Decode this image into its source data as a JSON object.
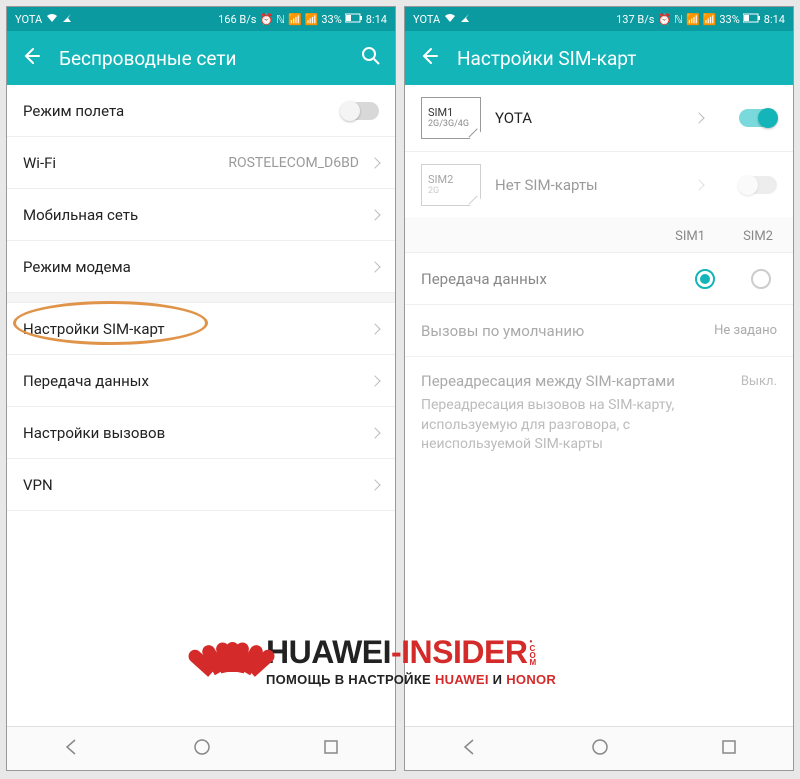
{
  "status": {
    "carrier": "YOTA",
    "speed_left": "166 B/s",
    "speed_right": "137 B/s",
    "battery": "33%",
    "time": "8:14"
  },
  "left_phone": {
    "header_title": "Беспроводные сети",
    "rows": [
      {
        "label": "Режим полета"
      },
      {
        "label": "Wi-Fi",
        "value": "ROSTELECOM_D6BD"
      },
      {
        "label": "Мобильная сеть"
      },
      {
        "label": "Режим модема"
      },
      {
        "label": "Настройки SIM-карт"
      },
      {
        "label": "Передача данных"
      },
      {
        "label": "Настройки вызовов"
      },
      {
        "label": "VPN"
      }
    ]
  },
  "right_phone": {
    "header_title": "Настройки SIM-карт",
    "sim1": {
      "name": "SIM1",
      "sub": "2G/3G/4G",
      "carrier": "YOTA"
    },
    "sim2": {
      "name": "SIM2",
      "sub": "2G",
      "carrier": "Нет SIM-карты"
    },
    "cols": {
      "c1": "SIM1",
      "c2": "SIM2"
    },
    "data_transfer": "Передача данных",
    "default_calls": {
      "label": "Вызовы по умолчанию",
      "value": "Не задано"
    },
    "forwarding": {
      "title": "Переадресация между SIM-картами",
      "desc": "Переадресация вызовов на SIM-карту, используемую для разговора, с неиспользуемой SIM-карты",
      "value": "Выкл."
    }
  },
  "logo": {
    "main1": "HUAWEI",
    "main2": "-INSIDER",
    "sub_pre": "ПОМОЩЬ В НАСТРОЙКЕ ",
    "sub_h": "HUAWEI",
    "sub_and": " И ",
    "sub_hn": "HONOR"
  }
}
